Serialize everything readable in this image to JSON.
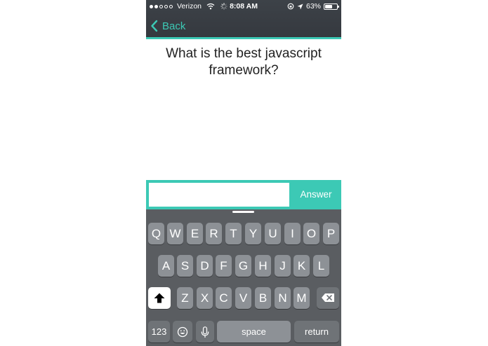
{
  "status_bar": {
    "carrier": "Verizon",
    "time": "8:08 AM",
    "battery": "63%",
    "battery_level": 0.63,
    "signal_dots_filled": 2,
    "signal_dots_total": 5
  },
  "nav": {
    "back_label": "Back",
    "accent_color": "#3cc9b5"
  },
  "question": {
    "text": "What is the best javascript framework?"
  },
  "answer": {
    "input_value": "",
    "input_placeholder": "",
    "button_label": "Answer"
  },
  "keyboard": {
    "row1": [
      "Q",
      "W",
      "E",
      "R",
      "T",
      "Y",
      "U",
      "I",
      "O",
      "P"
    ],
    "row2": [
      "A",
      "S",
      "D",
      "F",
      "G",
      "H",
      "J",
      "K",
      "L"
    ],
    "row3": [
      "Z",
      "X",
      "C",
      "V",
      "B",
      "N",
      "M"
    ],
    "numbers_label": "123",
    "space_label": "space",
    "return_label": "return",
    "icons": {
      "shift": "shift-icon",
      "backspace": "backspace-icon",
      "emoji": "emoji-icon",
      "mic": "microphone-icon"
    }
  }
}
